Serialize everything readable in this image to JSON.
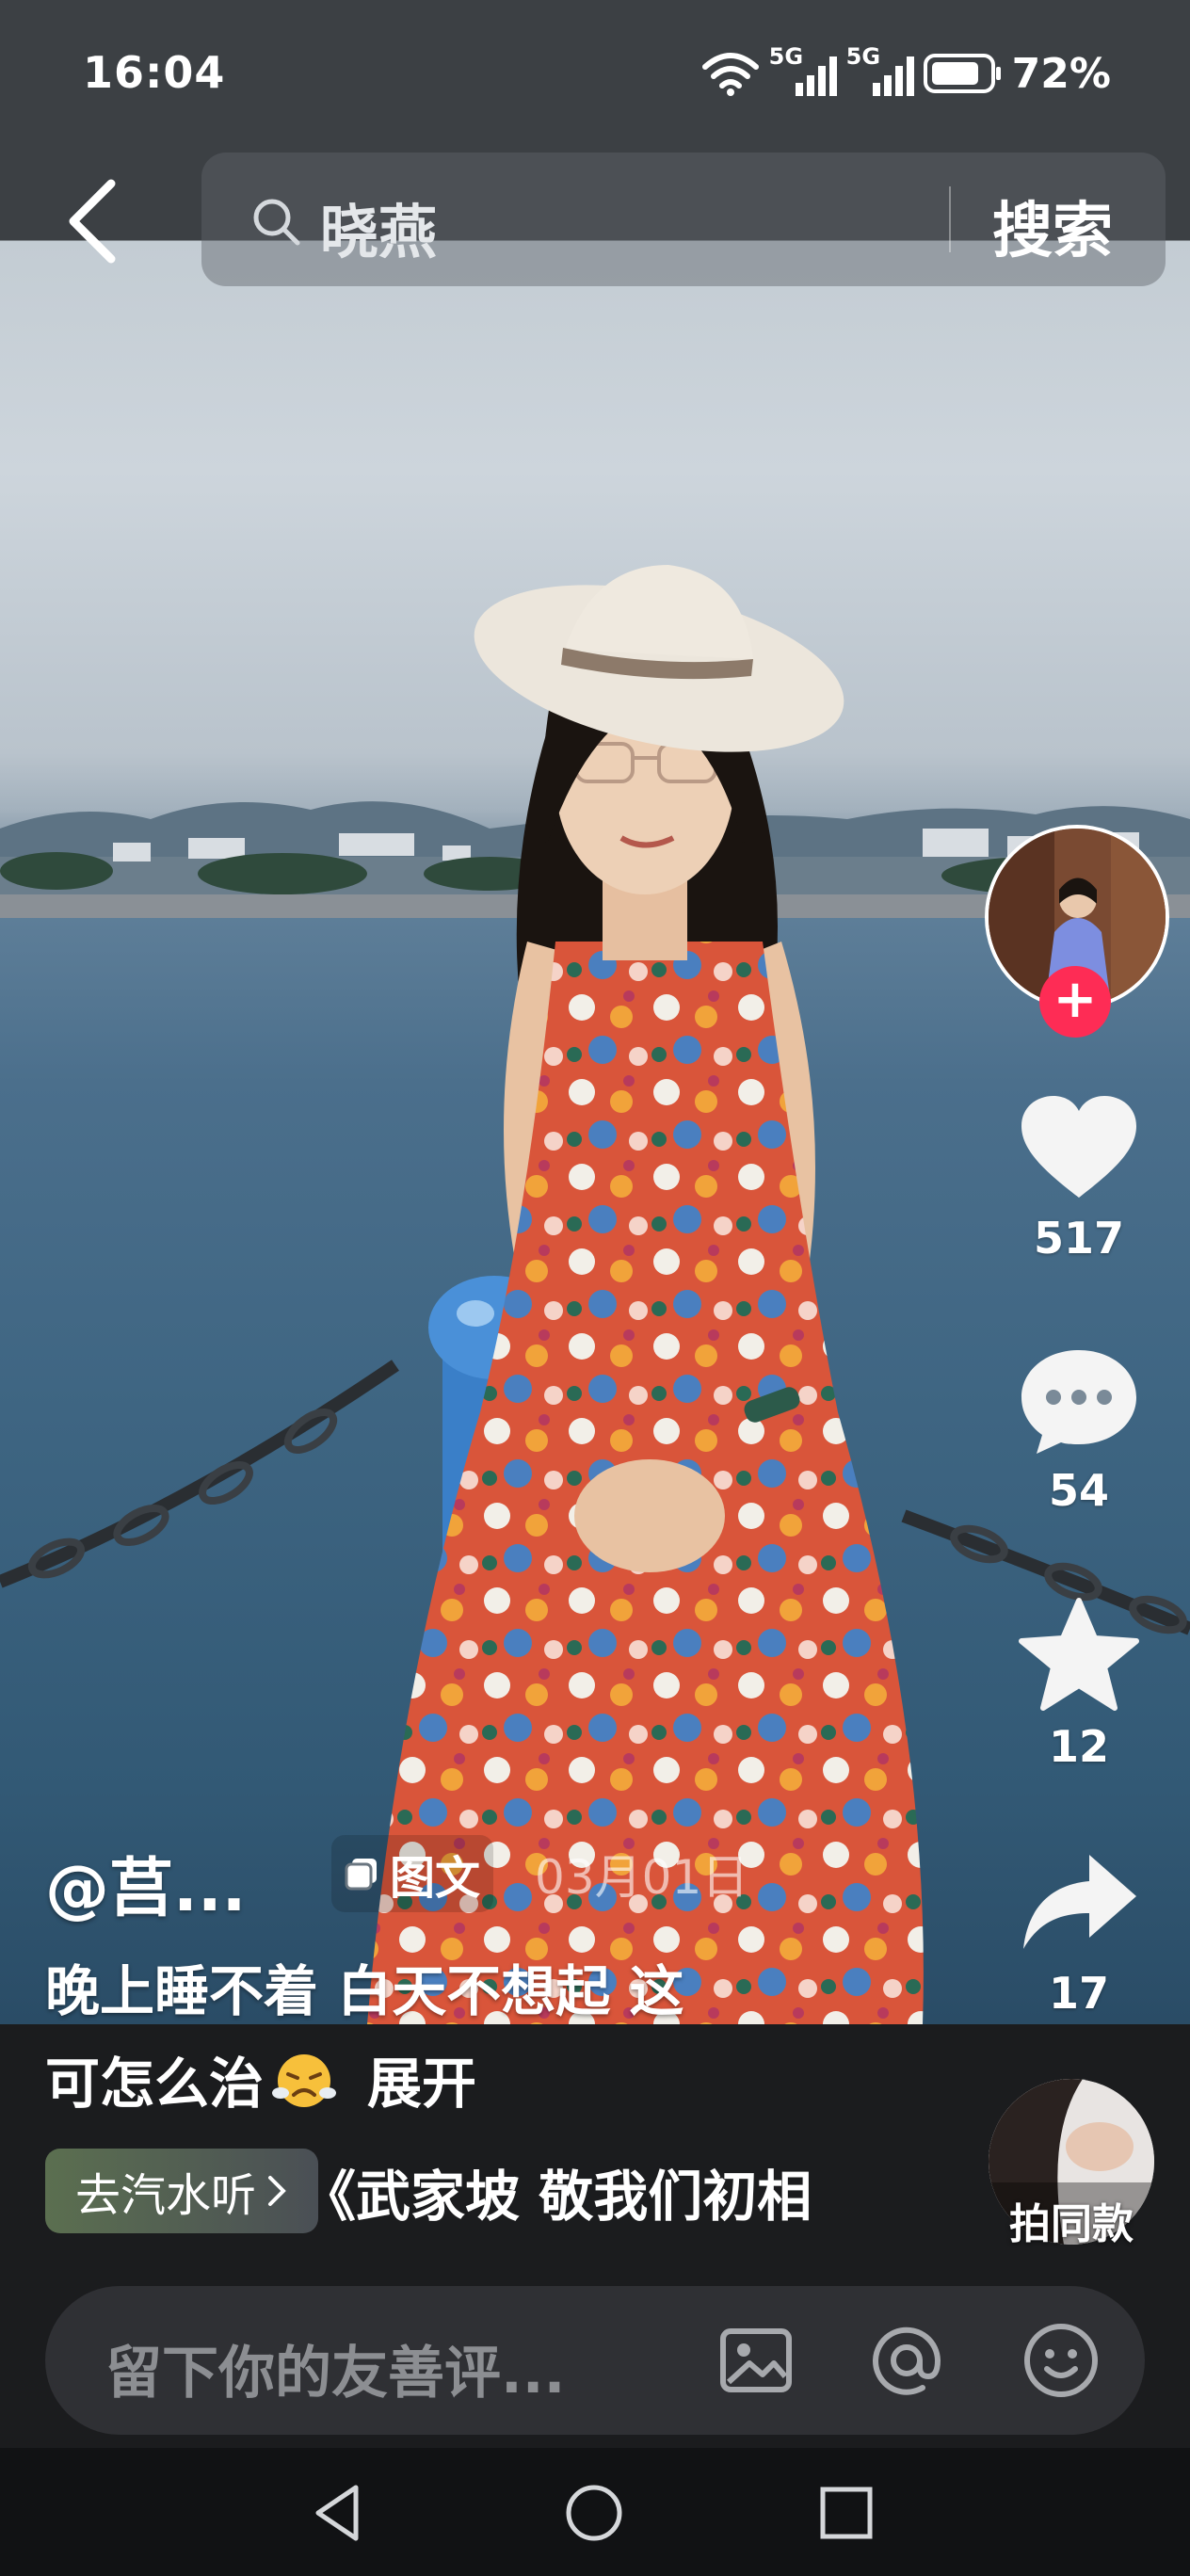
{
  "status_bar": {
    "time": "16:04",
    "signal_1": "5G",
    "signal_2": "5G",
    "battery_percent": "72%"
  },
  "search": {
    "query": "晓燕",
    "button_label": "搜索"
  },
  "actions": {
    "like_count": "517",
    "comment_count": "54",
    "favorite_count": "12",
    "share_count": "17"
  },
  "post": {
    "author": "@莒...",
    "type_tag": "图文",
    "date": "03月01日",
    "caption_line1": "晚上睡不着 白天不想起 这",
    "caption_line2": "可怎么治",
    "expand_label": "展开"
  },
  "music": {
    "pill_label": "去汽水听",
    "scroll_text": "《武家坡 敬我们初相"
  },
  "same_style_label": "拍同款",
  "comment": {
    "placeholder": "留下你的友善评..."
  },
  "colors": {
    "accent_red": "#fe2c55",
    "background": "#1b1c1e"
  },
  "icons": [
    "back-icon",
    "search-icon",
    "wifi-icon",
    "signal-icon",
    "battery-icon",
    "heart-icon",
    "comment-icon",
    "star-icon",
    "share-icon",
    "image-icon",
    "at-icon",
    "emoji-icon",
    "nav-back-icon",
    "nav-home-icon",
    "nav-recents-icon"
  ]
}
